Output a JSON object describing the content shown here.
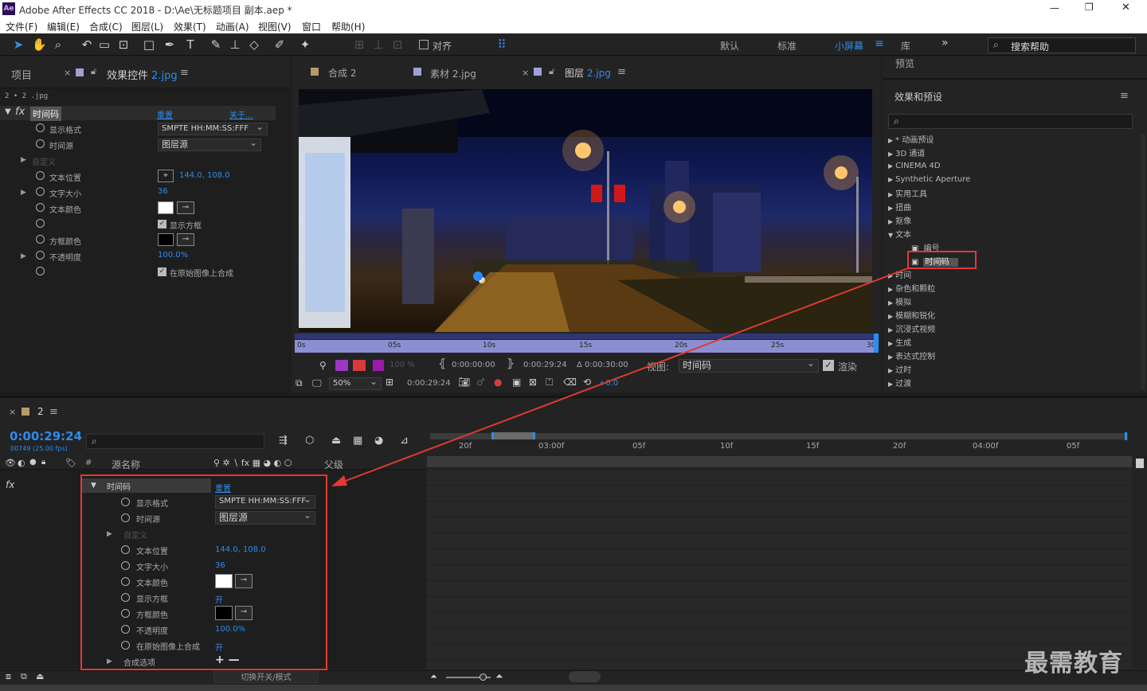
{
  "window": {
    "title": "Adobe After Effects CC 2018 - D:\\Ae\\无标题项目 副本.aep *",
    "logo": "Ae",
    "controls": [
      "—",
      "❐",
      "✕"
    ]
  },
  "menu": [
    "文件(F)",
    "编辑(E)",
    "合成(C)",
    "图层(L)",
    "效果(T)",
    "动画(A)",
    "视图(V)",
    "窗口",
    "帮助(H)"
  ],
  "toolbar": {
    "snap_label": "对齐",
    "workspaces": [
      "默认",
      "标准",
      "小屏幕"
    ],
    "lib": "库",
    "more": "»",
    "search_help": "搜索帮助"
  },
  "left_panel": {
    "tab_project": "项目",
    "tab_effects": "效果控件",
    "tab_effects_file": "2.jpg",
    "breadcrumb": "2 • 2 .jpg",
    "fx_name": "时间码",
    "reset": "重置",
    "about": "关于...",
    "rows": [
      {
        "label": "显示格式",
        "value": "SMPTE HH:MM:SS:FFF"
      },
      {
        "label": "时间源",
        "value": "图层源"
      },
      {
        "label": "自定义",
        "value": ""
      },
      {
        "label": "文本位置",
        "value": "144.0, 108.0"
      },
      {
        "label": "文字大小",
        "value": "36"
      },
      {
        "label": "文本颜色",
        "value": ""
      },
      {
        "label": "",
        "value": "显示方框"
      },
      {
        "label": "方框颜色",
        "value": ""
      },
      {
        "label": "不透明度",
        "value": "100.0%"
      },
      {
        "label": "",
        "value": "在原始图像上合成"
      }
    ]
  },
  "viewer": {
    "tabs": [
      {
        "label": "合成 2",
        "color": "#b99a6a"
      },
      {
        "label": "素材 2.jpg",
        "color": "#a0a0d8"
      },
      {
        "label": "图层",
        "file": "2.jpg",
        "color": "#a0a0d8"
      }
    ],
    "ruler": [
      "0s",
      "05s",
      "10s",
      "15s",
      "20s",
      "25s",
      "30s"
    ],
    "controls": {
      "opacity": "100 %",
      "in": "0:00:00:00",
      "out": "0:00:29:24",
      "duration": "Δ 0:00:30:00",
      "view_label": "视图:",
      "view_value": "时间码",
      "render": "渲染"
    },
    "bottom": {
      "zoom": "50%",
      "time": "0:00:29:24",
      "exposure": "+0.0"
    }
  },
  "right_panel": {
    "preview": "预览",
    "title": "效果和预设",
    "items": [
      {
        "label": "* 动画预设",
        "indent": 0
      },
      {
        "label": "3D 通道",
        "indent": 0
      },
      {
        "label": "CINEMA 4D",
        "indent": 0
      },
      {
        "label": "Synthetic Aperture",
        "indent": 0
      },
      {
        "label": "实用工具",
        "indent": 0
      },
      {
        "label": "扭曲",
        "indent": 0
      },
      {
        "label": "抠像",
        "indent": 0
      },
      {
        "label": "文本",
        "indent": 0,
        "open": true
      },
      {
        "label": "编号",
        "indent": 1
      },
      {
        "label": "时间码",
        "indent": 1,
        "selected": true
      },
      {
        "label": "时间",
        "indent": 0
      },
      {
        "label": "杂色和颗粒",
        "indent": 0
      },
      {
        "label": "模拟",
        "indent": 0
      },
      {
        "label": "模糊和锐化",
        "indent": 0
      },
      {
        "label": "沉浸式视频",
        "indent": 0
      },
      {
        "label": "生成",
        "indent": 0
      },
      {
        "label": "表达式控制",
        "indent": 0
      },
      {
        "label": "过时",
        "indent": 0
      },
      {
        "label": "过渡",
        "indent": 0
      }
    ]
  },
  "timeline": {
    "comp": "2",
    "timecode": "0:00:29:24",
    "frames": "00749 (25.00 fps)",
    "col_source": "源名称",
    "col_parent": "父级",
    "ruler": [
      "20f",
      "03:00f",
      "05f",
      "10f",
      "15f",
      "20f",
      "04:00f",
      "05f"
    ],
    "fx_label": "fx",
    "effect": "时间码",
    "reset": "重置",
    "rows": [
      {
        "label": "显示格式",
        "value": "SMPTE HH:MM:SS:FFF",
        "kind": "dd"
      },
      {
        "label": "时间源",
        "value": "图层源",
        "kind": "dd"
      },
      {
        "label": "自定义",
        "value": "",
        "kind": "dim"
      },
      {
        "label": "文本位置",
        "value": "144.0, 108.0",
        "kind": "val"
      },
      {
        "label": "文字大小",
        "value": "36",
        "kind": "val"
      },
      {
        "label": "文本颜色",
        "value": "",
        "kind": "white"
      },
      {
        "label": "显示方框",
        "value": "开",
        "kind": "val"
      },
      {
        "label": "方框颜色",
        "value": "",
        "kind": "black"
      },
      {
        "label": "不透明度",
        "value": "100.0%",
        "kind": "val"
      },
      {
        "label": "在原始图像上合成",
        "value": "开",
        "kind": "val"
      },
      {
        "label": "合成选项",
        "value": "+ —",
        "kind": "opt"
      }
    ],
    "footer": "切换开关/模式"
  },
  "watermark": "最需教育",
  "colors": {
    "accent": "#2d8ceb",
    "highlight": "#e03a33",
    "panel": "#232323"
  }
}
